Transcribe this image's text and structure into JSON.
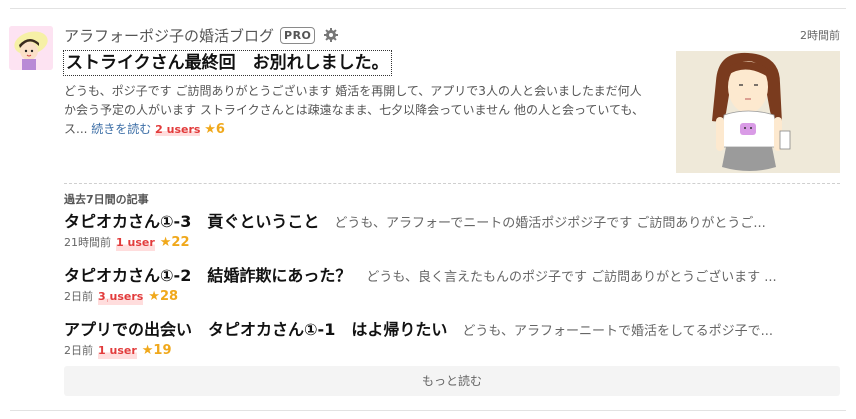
{
  "blog": {
    "name": "アラフォーポジ子の婚活ブログ",
    "pro_badge": "PRO",
    "settings_icon": "gear-icon",
    "avatar_icon": "blog-avatar"
  },
  "main_entry": {
    "time": "2時間前",
    "title": "ストライクさん最終回　お別れしました。",
    "excerpt": "どうも、ポジ子です ご訪問ありがとうございます 婚活を再開して、アプリで3人の人と会いましたまだ何人か会う予定の人がいます ストライクさんとは疎遠なまま、七夕以降会っていません 他の人と会っていても、ス...",
    "read_more": "続きを読む",
    "users": "2 users",
    "stars": "★6"
  },
  "section_label": "過去7日間の記事",
  "entries": [
    {
      "title": "タピオカさん①-3　貢ぐということ",
      "excerpt": "どうも、アラフォーでニートの婚活ポジポジ子です ご訪問ありがとうご...",
      "time": "21時間前",
      "users": "1 user",
      "stars": "★22"
    },
    {
      "title": "タピオカさん①-2　結婚詐欺にあった？",
      "excerpt": "どうも、良く言えたもんのポジ子です ご訪問ありがとうございます ...",
      "time": "2日前",
      "users": "3 users",
      "stars": "★28"
    },
    {
      "title": "アプリでの出会い　タピオカさん①-1　はよ帰りたい",
      "excerpt": "どうも、アラフォーニートで婚活をしてるポジ子で...",
      "time": "2日前",
      "users": "1 user",
      "stars": "★19"
    }
  ],
  "more_button": "もっと読む",
  "colors": {
    "users_red": "#e23b3b",
    "star_orange": "#f0a81b",
    "link_blue": "#3c6ea6"
  }
}
